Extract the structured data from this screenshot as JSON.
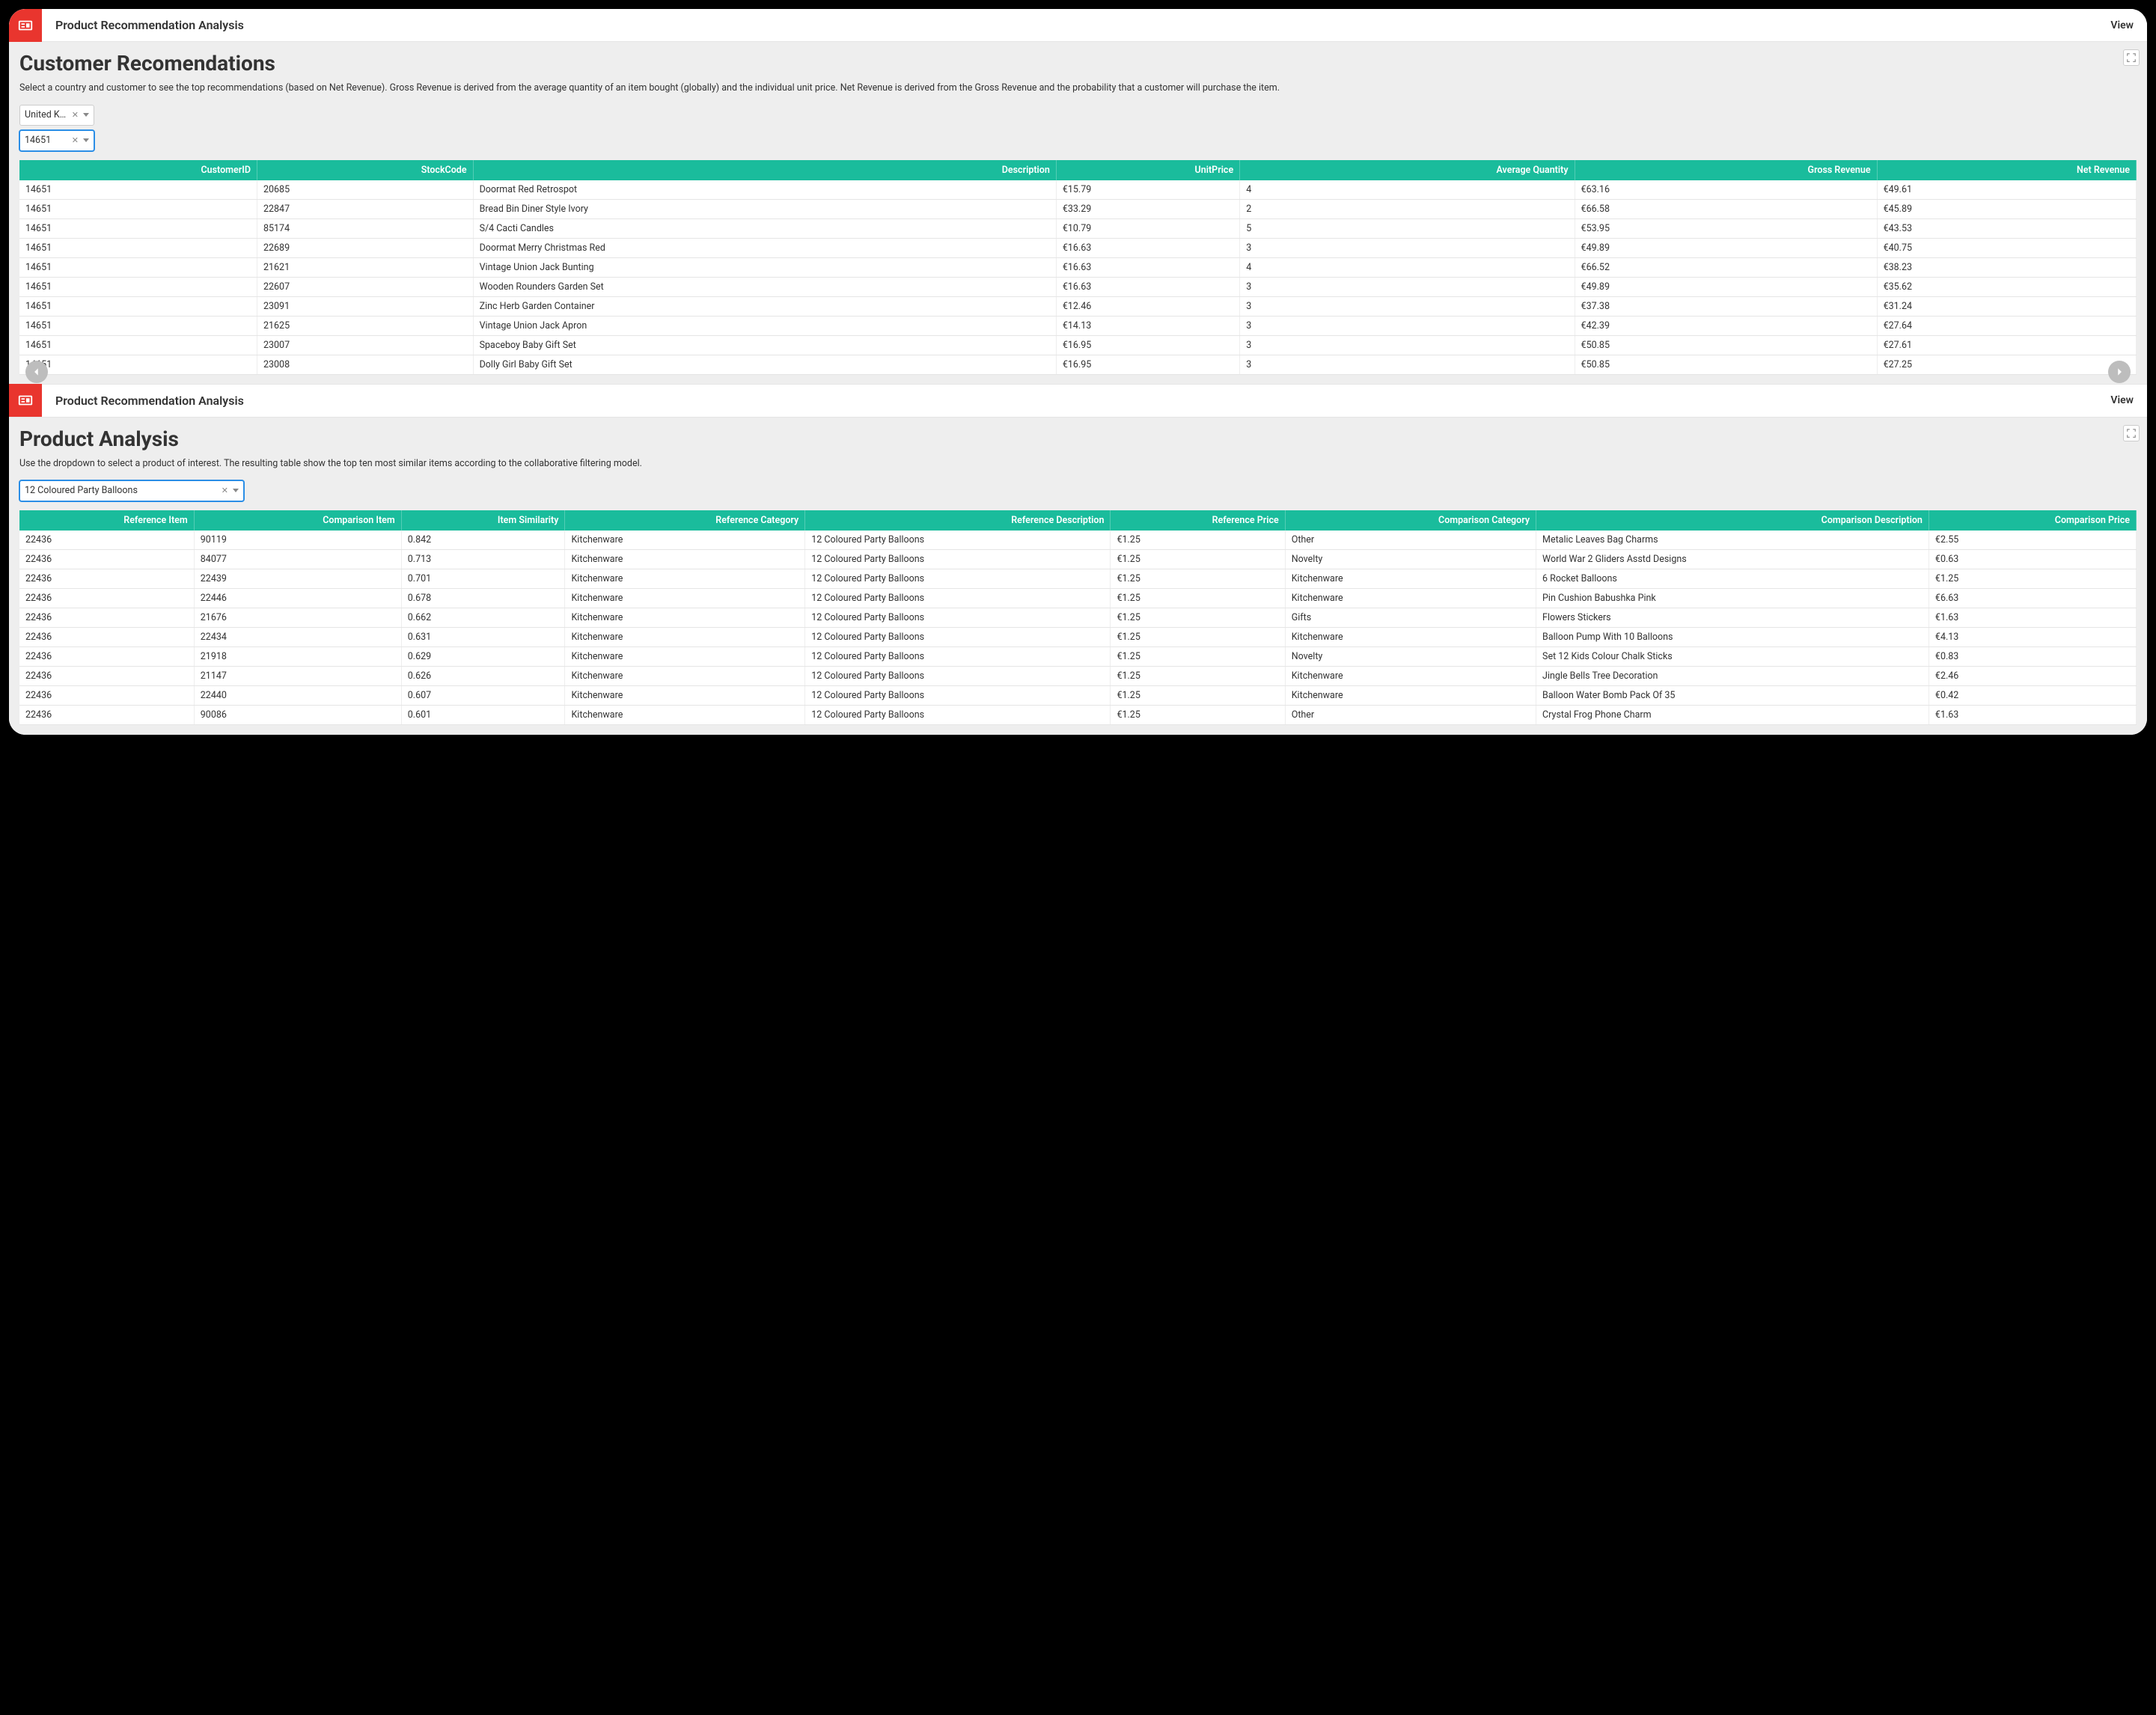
{
  "colors": {
    "accent": "#1abc9c",
    "danger": "#e9352e"
  },
  "panel1": {
    "header_title": "Product Recommendation Analysis",
    "view_label": "View",
    "heading": "Customer Recomendations",
    "description": "Select a country and customer to see the top recommendations (based on Net Revenue). Gross Revenue is derived from the average quantity of an item bought (globally) and the individual unit price. Net Revenue is derived from the Gross Revenue and the probability that a customer will purchase the item.",
    "country_selected": "United King…",
    "customer_selected": "14651",
    "columns": [
      "CustomerID",
      "StockCode",
      "Description",
      "UnitPrice",
      "Average Quantity",
      "Gross Revenue",
      "Net Revenue"
    ],
    "rows": [
      {
        "CustomerID": "14651",
        "StockCode": "20685",
        "Description": "Doormat Red Retrospot",
        "UnitPrice": "€15.79",
        "AverageQuantity": "4",
        "GrossRevenue": "€63.16",
        "NetRevenue": "€49.61"
      },
      {
        "CustomerID": "14651",
        "StockCode": "22847",
        "Description": "Bread Bin Diner Style Ivory",
        "UnitPrice": "€33.29",
        "AverageQuantity": "2",
        "GrossRevenue": "€66.58",
        "NetRevenue": "€45.89"
      },
      {
        "CustomerID": "14651",
        "StockCode": "85174",
        "Description": "S/4 Cacti Candles",
        "UnitPrice": "€10.79",
        "AverageQuantity": "5",
        "GrossRevenue": "€53.95",
        "NetRevenue": "€43.53"
      },
      {
        "CustomerID": "14651",
        "StockCode": "22689",
        "Description": "Doormat Merry Christmas Red",
        "UnitPrice": "€16.63",
        "AverageQuantity": "3",
        "GrossRevenue": "€49.89",
        "NetRevenue": "€40.75"
      },
      {
        "CustomerID": "14651",
        "StockCode": "21621",
        "Description": "Vintage Union Jack Bunting",
        "UnitPrice": "€16.63",
        "AverageQuantity": "4",
        "GrossRevenue": "€66.52",
        "NetRevenue": "€38.23"
      },
      {
        "CustomerID": "14651",
        "StockCode": "22607",
        "Description": "Wooden Rounders Garden Set",
        "UnitPrice": "€16.63",
        "AverageQuantity": "3",
        "GrossRevenue": "€49.89",
        "NetRevenue": "€35.62"
      },
      {
        "CustomerID": "14651",
        "StockCode": "23091",
        "Description": "Zinc Herb Garden Container",
        "UnitPrice": "€12.46",
        "AverageQuantity": "3",
        "GrossRevenue": "€37.38",
        "NetRevenue": "€31.24"
      },
      {
        "CustomerID": "14651",
        "StockCode": "21625",
        "Description": "Vintage Union Jack Apron",
        "UnitPrice": "€14.13",
        "AverageQuantity": "3",
        "GrossRevenue": "€42.39",
        "NetRevenue": "€27.64"
      },
      {
        "CustomerID": "14651",
        "StockCode": "23007",
        "Description": "Spaceboy Baby Gift Set",
        "UnitPrice": "€16.95",
        "AverageQuantity": "3",
        "GrossRevenue": "€50.85",
        "NetRevenue": "€27.61"
      },
      {
        "CustomerID": "14651",
        "StockCode": "23008",
        "Description": "Dolly Girl Baby Gift Set",
        "UnitPrice": "€16.95",
        "AverageQuantity": "3",
        "GrossRevenue": "€50.85",
        "NetRevenue": "€27.25"
      }
    ]
  },
  "panel2": {
    "header_title": "Product Recommendation Analysis",
    "view_label": "View",
    "heading": "Product Analysis",
    "description": "Use the dropdown to select a product of interest. The resulting table show the top ten most similar items according to the collaborative filtering model.",
    "product_selected": "12 Coloured Party Balloons",
    "columns": [
      "Reference Item",
      "Comparison Item",
      "Item Similarity",
      "Reference Category",
      "Reference Description",
      "Reference Price",
      "Comparison Category",
      "Comparison Description",
      "Comparison Price"
    ],
    "rows": [
      {
        "ReferenceItem": "22436",
        "ComparisonItem": "90119",
        "ItemSimilarity": "0.842",
        "ReferenceCategory": "Kitchenware",
        "ReferenceDescription": "12 Coloured Party Balloons",
        "ReferencePrice": "€1.25",
        "ComparisonCategory": "Other",
        "ComparisonDescription": "Metalic Leaves Bag Charms",
        "ComparisonPrice": "€2.55"
      },
      {
        "ReferenceItem": "22436",
        "ComparisonItem": "84077",
        "ItemSimilarity": "0.713",
        "ReferenceCategory": "Kitchenware",
        "ReferenceDescription": "12 Coloured Party Balloons",
        "ReferencePrice": "€1.25",
        "ComparisonCategory": "Novelty",
        "ComparisonDescription": "World War 2 Gliders Asstd Designs",
        "ComparisonPrice": "€0.63"
      },
      {
        "ReferenceItem": "22436",
        "ComparisonItem": "22439",
        "ItemSimilarity": "0.701",
        "ReferenceCategory": "Kitchenware",
        "ReferenceDescription": "12 Coloured Party Balloons",
        "ReferencePrice": "€1.25",
        "ComparisonCategory": "Kitchenware",
        "ComparisonDescription": "6 Rocket Balloons",
        "ComparisonPrice": "€1.25"
      },
      {
        "ReferenceItem": "22436",
        "ComparisonItem": "22446",
        "ItemSimilarity": "0.678",
        "ReferenceCategory": "Kitchenware",
        "ReferenceDescription": "12 Coloured Party Balloons",
        "ReferencePrice": "€1.25",
        "ComparisonCategory": "Kitchenware",
        "ComparisonDescription": "Pin Cushion Babushka Pink",
        "ComparisonPrice": "€6.63"
      },
      {
        "ReferenceItem": "22436",
        "ComparisonItem": "21676",
        "ItemSimilarity": "0.662",
        "ReferenceCategory": "Kitchenware",
        "ReferenceDescription": "12 Coloured Party Balloons",
        "ReferencePrice": "€1.25",
        "ComparisonCategory": "Gifts",
        "ComparisonDescription": "Flowers Stickers",
        "ComparisonPrice": "€1.63"
      },
      {
        "ReferenceItem": "22436",
        "ComparisonItem": "22434",
        "ItemSimilarity": "0.631",
        "ReferenceCategory": "Kitchenware",
        "ReferenceDescription": "12 Coloured Party Balloons",
        "ReferencePrice": "€1.25",
        "ComparisonCategory": "Kitchenware",
        "ComparisonDescription": "Balloon Pump With 10 Balloons",
        "ComparisonPrice": "€4.13"
      },
      {
        "ReferenceItem": "22436",
        "ComparisonItem": "21918",
        "ItemSimilarity": "0.629",
        "ReferenceCategory": "Kitchenware",
        "ReferenceDescription": "12 Coloured Party Balloons",
        "ReferencePrice": "€1.25",
        "ComparisonCategory": "Novelty",
        "ComparisonDescription": "Set 12 Kids Colour Chalk Sticks",
        "ComparisonPrice": "€0.83"
      },
      {
        "ReferenceItem": "22436",
        "ComparisonItem": "21147",
        "ItemSimilarity": "0.626",
        "ReferenceCategory": "Kitchenware",
        "ReferenceDescription": "12 Coloured Party Balloons",
        "ReferencePrice": "€1.25",
        "ComparisonCategory": "Kitchenware",
        "ComparisonDescription": "Jingle Bells Tree Decoration",
        "ComparisonPrice": "€2.46"
      },
      {
        "ReferenceItem": "22436",
        "ComparisonItem": "22440",
        "ItemSimilarity": "0.607",
        "ReferenceCategory": "Kitchenware",
        "ReferenceDescription": "12 Coloured Party Balloons",
        "ReferencePrice": "€1.25",
        "ComparisonCategory": "Kitchenware",
        "ComparisonDescription": "Balloon Water Bomb Pack Of 35",
        "ComparisonPrice": "€0.42"
      },
      {
        "ReferenceItem": "22436",
        "ComparisonItem": "90086",
        "ItemSimilarity": "0.601",
        "ReferenceCategory": "Kitchenware",
        "ReferenceDescription": "12 Coloured Party Balloons",
        "ReferencePrice": "€1.25",
        "ComparisonCategory": "Other",
        "ComparisonDescription": "Crystal Frog Phone Charm",
        "ComparisonPrice": "€1.63"
      }
    ]
  }
}
